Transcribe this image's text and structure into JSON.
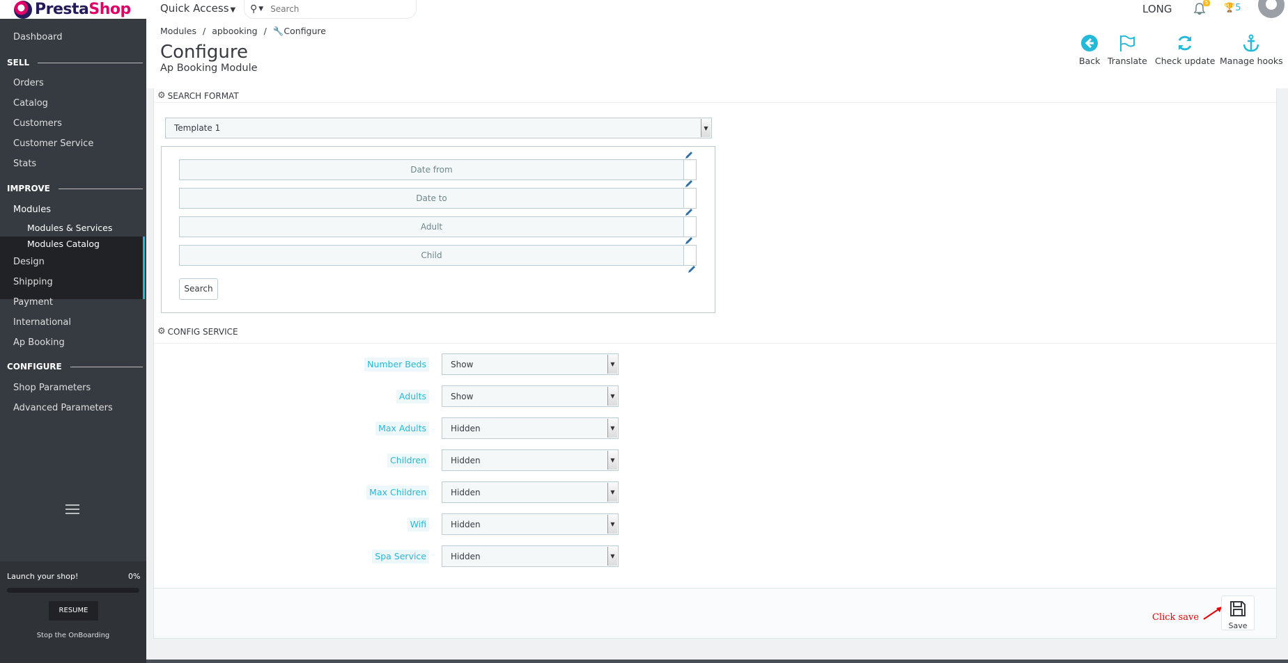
{
  "header": {
    "logo_text_presta": "Presta",
    "logo_text_shop": "Shop",
    "quick_access": "Quick Access",
    "search_placeholder": "Search",
    "user_name": "LONG",
    "notifications_count": "5",
    "trophy_count": "5"
  },
  "sidebar": {
    "dashboard": "Dashboard",
    "sections": {
      "sell": "SELL",
      "improve": "IMPROVE",
      "configure": "CONFIGURE"
    },
    "sell_items": [
      "Orders",
      "Catalog",
      "Customers",
      "Customer Service",
      "Stats"
    ],
    "modules": "Modules",
    "modules_sub": [
      "Modules & Services",
      "Modules Catalog"
    ],
    "improve_items": [
      "Design",
      "Shipping",
      "Payment",
      "International",
      "Ap Booking"
    ],
    "configure_items": [
      "Shop Parameters",
      "Advanced Parameters"
    ],
    "onboarding": {
      "launch_text": "Launch your shop!",
      "percent_text": "0%",
      "progress": 0,
      "resume_label": "RESUME",
      "stop_label": "Stop the OnBoarding"
    }
  },
  "page": {
    "breadcrumb": [
      "Modules",
      "apbooking",
      "Configure"
    ],
    "title": "Configure",
    "subtitle": "Ap Booking Module",
    "toolbar": {
      "back": "Back",
      "translate": "Translate",
      "check_update": "Check update",
      "manage_hooks": "Manage hooks"
    }
  },
  "search_format": {
    "heading": "SEARCH FORMAT",
    "template_selected": "Template 1",
    "fields": [
      "Date from",
      "Date to",
      "Adult",
      "Child"
    ],
    "search_button": "Search"
  },
  "config_service": {
    "heading": "CONFIG SERVICE",
    "rows": [
      {
        "label": "Number Beds",
        "value": "Show"
      },
      {
        "label": "Adults",
        "value": "Show"
      },
      {
        "label": "Max Adults",
        "value": "Hidden"
      },
      {
        "label": "Children",
        "value": "Hidden"
      },
      {
        "label": "Max Children",
        "value": "Hidden"
      },
      {
        "label": "Wifi",
        "value": "Hidden"
      },
      {
        "label": "Spa Service",
        "value": "Hidden"
      }
    ]
  },
  "footer": {
    "save_label": "Save",
    "annotation": "Click save"
  },
  "colors": {
    "accent": "#25b9d7",
    "sidebar_bg": "#363a41",
    "annotation_red": "#e30000"
  }
}
